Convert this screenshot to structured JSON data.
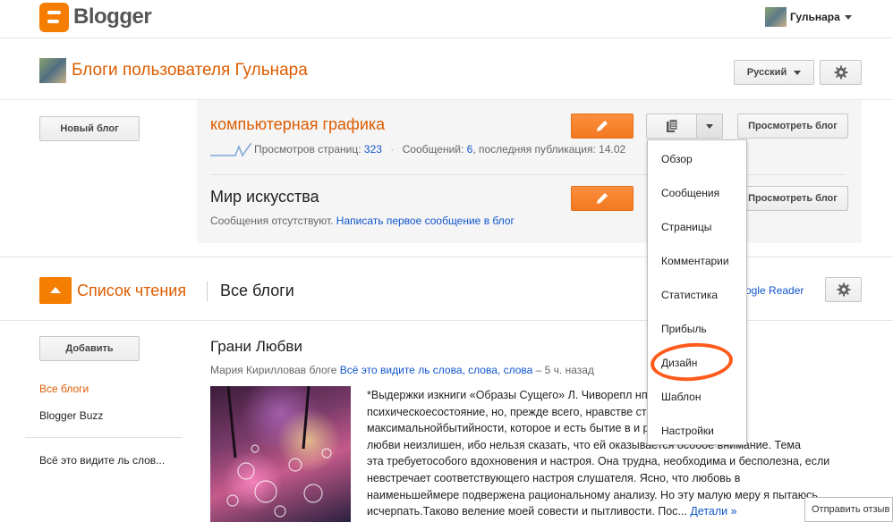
{
  "header": {
    "logo_text": "Blogger",
    "user_name": "Гульнара"
  },
  "page": {
    "title": "Блоги пользователя Гульнара",
    "language_button": "Русский",
    "new_blog_button": "Новый блог"
  },
  "blogs": [
    {
      "title": "компьютерная графика",
      "views_label": "Просмотров страниц:",
      "views_value": "323",
      "separator": "·",
      "posts_label": "Сообщений:",
      "posts_value": "6",
      "last_post": ", последняя публикация: 14.02",
      "view_button": "Просмотреть блог"
    },
    {
      "title": "Мир искусства",
      "no_posts": "Сообщения отсутствуют.",
      "write_first": "Написать первое сообщение в блог",
      "view_button": "Просмотреть блог"
    }
  ],
  "dropdown": {
    "items": [
      "Обзор",
      "Сообщения",
      "Страницы",
      "Комментарии",
      "Статистика",
      "Прибыль",
      "Дизайн",
      "Шаблон",
      "Настройки"
    ]
  },
  "reading": {
    "title": "Список чтения",
    "all_blogs": "Все блоги",
    "google_reader": "ogle Reader",
    "add_button": "Добавить",
    "nav": [
      "Все блоги",
      "Blogger Buzz",
      "Всё это видите ль слов..."
    ]
  },
  "post": {
    "title": "Грани Любви",
    "author": "Мария Кирилловав блоге",
    "blog_link": "Всё это видите ль слова, слова, слова",
    "time": "– 5 ч. назад",
    "lines": [
      "*Выдержки изкниги «Образы Сущего» Л. Чиворепл                    нпросто",
      "психическоесостояние, но, прежде всего, нравстве                   стояние",
      "максимальнойбытийности, которое и есть бытие в и                   разговор о",
      "любви неизлишен, ибо нельзя сказать, что ей оказывается особое внимание. Тема",
      "эта требуетособого вдохновения и настроя. Она трудна, необходима и бесполезна, если",
      "невстречает соответствующего настроя слушателя. Ясно, что любовь в",
      "наименьшеймере подвержена рациональному анализу. Но эту малую меру я пытаюсь",
      "исчерпать.Таково веление моей совести и пытливости. Пос..."
    ],
    "more": "Детали »"
  },
  "feedback": "Отправить отзыв",
  "colors": {
    "accent": "#f57d00",
    "title_orange": "#dd5c00",
    "link": "#1155cc",
    "annotation": "#ff5a1a"
  }
}
